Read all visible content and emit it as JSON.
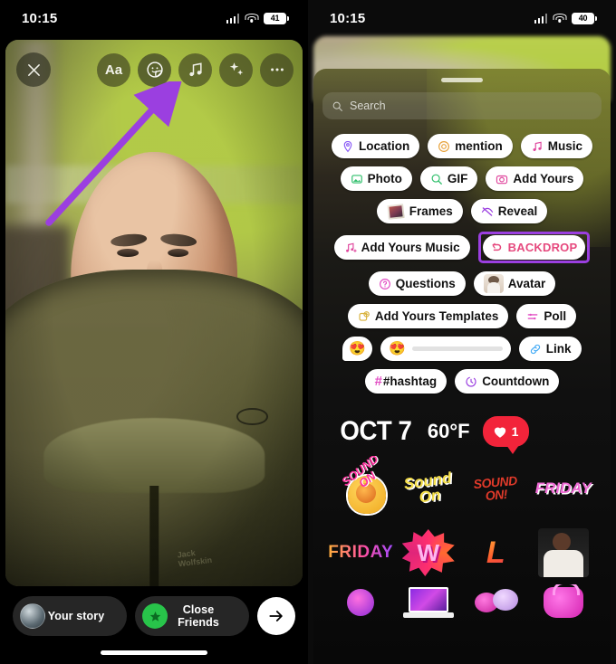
{
  "left_phone": {
    "status": {
      "time": "10:15",
      "battery": "41",
      "signal_icon": "cellular-bars-icon",
      "wifi_icon": "wifi-icon",
      "battery_icon": "battery-icon"
    },
    "toolbar": {
      "close_label": "close-icon",
      "tools": [
        {
          "name": "text-tool",
          "label": "Aa",
          "icon": "text-aa-icon",
          "active": false
        },
        {
          "name": "sticker-tool",
          "label": "",
          "icon": "sticker-smiley-icon",
          "active": true
        },
        {
          "name": "music-tool",
          "label": "",
          "icon": "music-note-icon",
          "active": false
        },
        {
          "name": "effects-tool",
          "label": "",
          "icon": "sparkles-icon",
          "active": false
        },
        {
          "name": "more-tool",
          "label": "",
          "icon": "ellipsis-icon",
          "active": false
        }
      ]
    },
    "annotation": {
      "type": "arrow",
      "color": "#9b3fe0",
      "points_to": "sticker-tool"
    },
    "bottom_bar": {
      "your_story_label": "Your story",
      "close_friends_label": "Close Friends",
      "next_label": "arrow-right-icon"
    }
  },
  "right_phone": {
    "status": {
      "time": "10:15",
      "battery": "40"
    },
    "sheet": {
      "grabber": "drag-handle"
    },
    "search": {
      "placeholder": "Search",
      "icon": "search-icon"
    },
    "sticker_rows": [
      [
        {
          "label": "Location",
          "icon": "location-pin-icon",
          "icon_color": "#8b5cf6"
        },
        {
          "label": "mention",
          "icon": "at-mention-icon",
          "icon_color": "#e8a33d"
        },
        {
          "label": "Music",
          "icon": "music-note-icon",
          "icon_color": "#e0479e"
        }
      ],
      [
        {
          "label": "Photo",
          "icon": "photo-icon",
          "icon_color": "#2fbf6b"
        },
        {
          "label": "GIF",
          "icon": "gif-search-icon",
          "icon_color": "#2fbf6b"
        },
        {
          "label": "Add Yours",
          "icon": "camera-icon",
          "icon_color": "#e0479e"
        }
      ],
      [
        {
          "label": "Frames",
          "icon": "polaroid-frame-icon",
          "icon_color": "#b8564d"
        },
        {
          "label": "Reveal",
          "icon": "eye-slash-icon",
          "icon_color": "#9b3fe0"
        }
      ],
      [
        {
          "label": "Add Yours Music",
          "icon": "music-add-icon",
          "icon_color": "#e0479e"
        },
        {
          "label": "BACKDROP",
          "icon": "backdrop-icon",
          "icon_color": "#e6497e",
          "highlighted": true
        }
      ],
      [
        {
          "label": "Questions",
          "icon": "question-mark-icon",
          "icon_color": "#e24fc4"
        },
        {
          "label": "Avatar",
          "icon": "avatar-face-icon",
          "icon_color": "#d8cabb"
        }
      ],
      [
        {
          "label": "Add Yours Templates",
          "icon": "template-add-icon",
          "icon_color": "#d8b23d"
        },
        {
          "label": "Poll",
          "icon": "poll-bars-icon",
          "icon_color": "#e24fc4"
        }
      ]
    ],
    "emoji_row": {
      "reaction_emoji": "😍",
      "slider_emoji": "😍",
      "link_label": "Link",
      "link_icon": "link-chain-icon"
    },
    "tag_row": [
      {
        "label": "#hashtag",
        "icon": "hashtag-icon",
        "icon_color": "#e24fc4"
      },
      {
        "label": "Countdown",
        "icon": "countdown-clock-icon",
        "icon_color": "#9b3fe0"
      }
    ],
    "date_weather": {
      "date": "OCT 7",
      "temperature": "60°F",
      "heart_count": "1",
      "heart_icon": "heart-icon",
      "heart_color": "#f2243a"
    },
    "gif_grid_row1": [
      {
        "name": "sound-on-hand-sticker",
        "text": "SOUND ON"
      },
      {
        "name": "sound-on-swirl-sticker",
        "text": "Sound On"
      },
      {
        "name": "sound-on-red-sticker",
        "text": "SOUND ON!"
      },
      {
        "name": "friday-bubble-sticker",
        "text": "FRIDAY"
      }
    ],
    "gif_grid_row2": [
      {
        "name": "friday-gradient-sticker",
        "text": "FRIDAY"
      },
      {
        "name": "w-burst-sticker",
        "text": "W"
      },
      {
        "name": "lightning-bolt-sticker",
        "text": "L"
      },
      {
        "name": "person-wave-sticker",
        "text": ""
      }
    ],
    "gif_grid_row3": [
      {
        "name": "pink-eyes-sticker",
        "text": ""
      },
      {
        "name": "laptop-sticker",
        "text": ""
      },
      {
        "name": "party-hats-sticker",
        "text": ""
      },
      {
        "name": "pink-bag-sticker",
        "text": ""
      }
    ]
  }
}
